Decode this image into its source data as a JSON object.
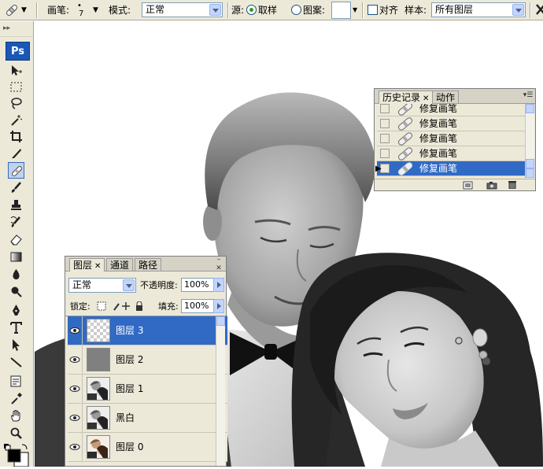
{
  "options_bar": {
    "brush_label": "画笔:",
    "brush_size": "7",
    "mode_label": "模式:",
    "mode_value": "正常",
    "source_label": "源:",
    "source_sampled": "取样",
    "source_pattern": "图案:",
    "aligned_label": "对齐",
    "sample_label": "样本:",
    "sample_value": "所有图层"
  },
  "toolbox": {
    "logo": "Ps",
    "grip": "▸▸"
  },
  "history_panel": {
    "tabs": [
      {
        "label": "历史记录"
      },
      {
        "label": "动作"
      }
    ],
    "items": [
      {
        "label": "修复画笔"
      },
      {
        "label": "修复画笔"
      },
      {
        "label": "修复画笔"
      },
      {
        "label": "修复画笔"
      },
      {
        "label": "修复画笔"
      }
    ],
    "selected_index": 4
  },
  "layers_panel": {
    "tabs": [
      {
        "label": "图层"
      },
      {
        "label": "通道"
      },
      {
        "label": "路径"
      }
    ],
    "blend_mode": "正常",
    "opacity_label": "不透明度:",
    "opacity_value": "100%",
    "lock_label": "锁定:",
    "fill_label": "填充:",
    "fill_value": "100%",
    "layers": [
      {
        "name": "图层 3",
        "thumb": "transparent"
      },
      {
        "name": "图层 2",
        "thumb": "gray"
      },
      {
        "name": "图层 1",
        "thumb": "photo-bw"
      },
      {
        "name": "黑白",
        "thumb": "photo-bw"
      },
      {
        "name": "图层 0",
        "thumb": "photo-color"
      }
    ],
    "selected_index": 0
  },
  "colors": {
    "chrome": "#ece9d8",
    "selection": "#316ac5",
    "ps_logo": "#1a57b6"
  }
}
